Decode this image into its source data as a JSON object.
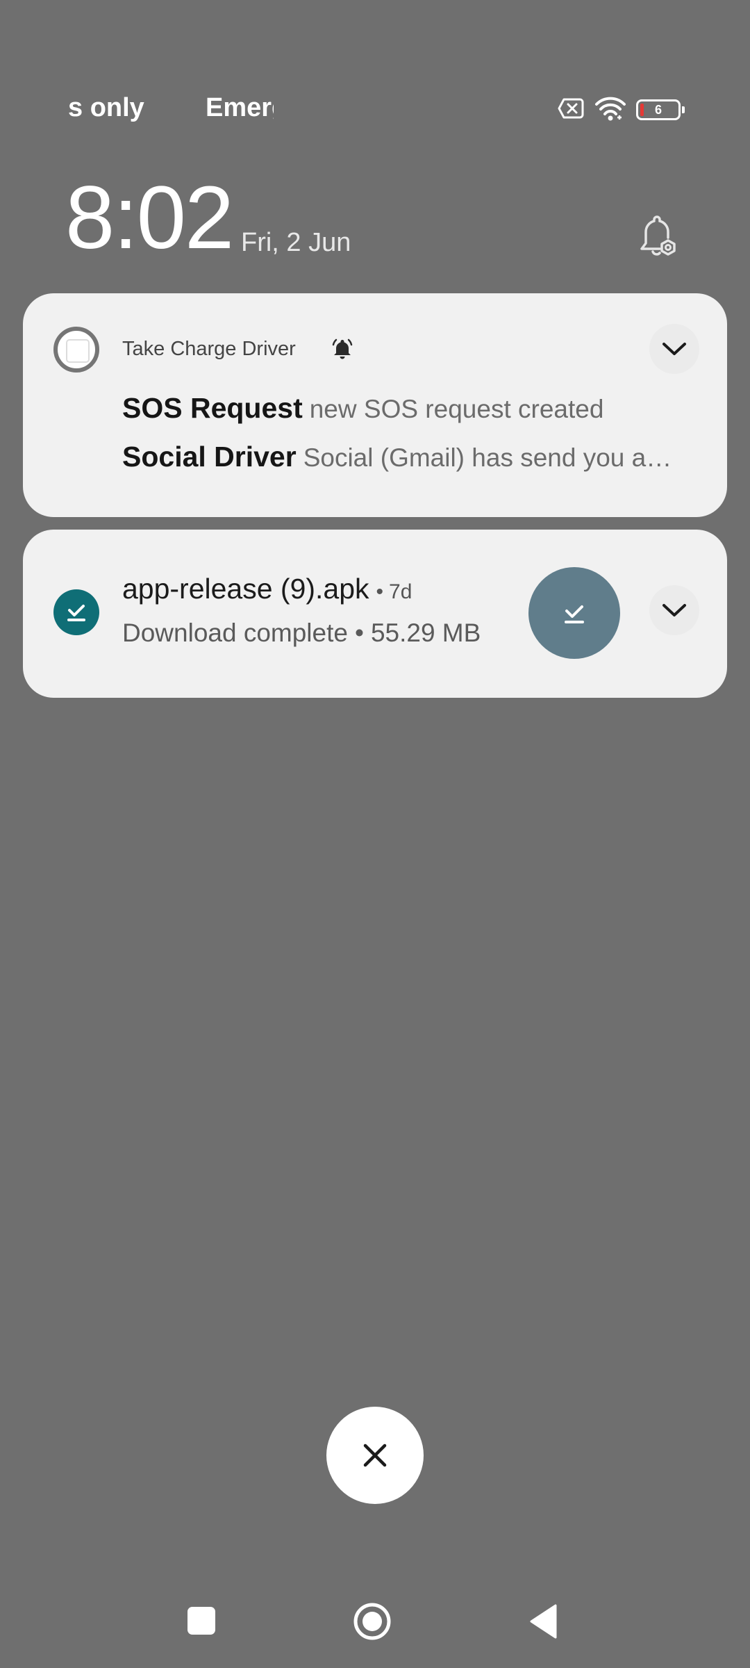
{
  "status_bar": {
    "carrier_left": "s only",
    "carrier_right": "Emerg",
    "battery_level": "6",
    "icons": [
      "sim-disabled-icon",
      "wifi-icon",
      "battery-icon"
    ]
  },
  "lockscreen": {
    "time": "8:02",
    "date": "Fri, 2 Jun"
  },
  "notifications": [
    {
      "app_name": "Take Charge Driver",
      "icon": "app-icon",
      "messages": [
        {
          "title": "SOS Request",
          "body": "new SOS request created"
        },
        {
          "title": "Social Driver",
          "body": "Social (Gmail) has send you a…"
        }
      ]
    },
    {
      "title": "app-release (9).apk",
      "separator": "•",
      "age": "7d",
      "status": "Download complete",
      "size": "55.29 MB",
      "icon": "download-done-icon"
    }
  ],
  "colors": {
    "background": "#6f6f6f",
    "card": "#f1f1f1",
    "download_icon": "#0f6e76",
    "install_button": "#607d8b"
  }
}
